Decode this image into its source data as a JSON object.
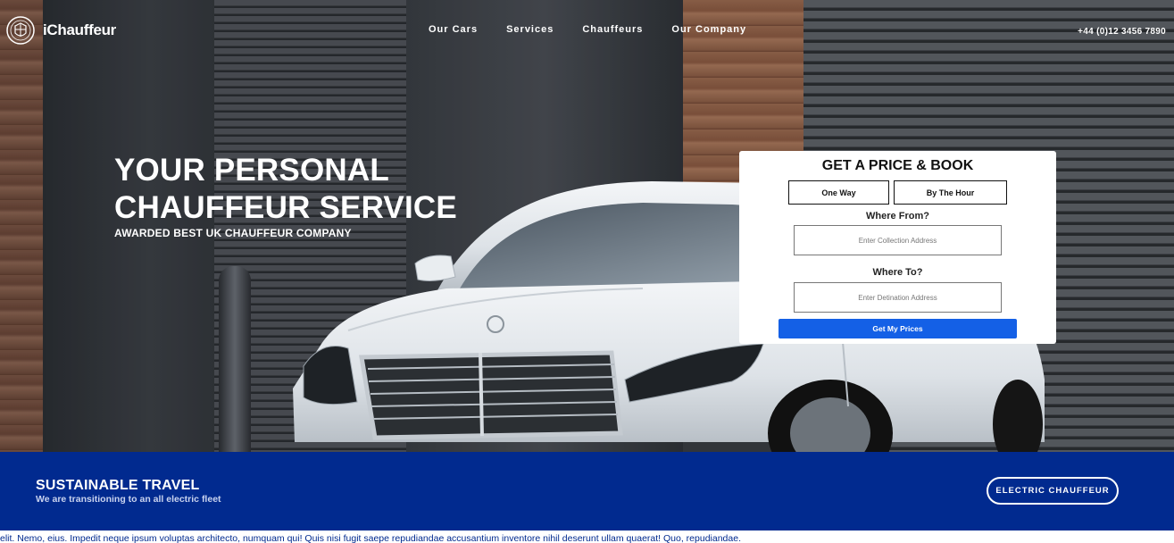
{
  "brand": {
    "name": "iChauffeur",
    "logo_icon": "crest-icon"
  },
  "nav": {
    "items": [
      "Our Cars",
      "Services",
      "Chauffeurs",
      "Our Company"
    ]
  },
  "phone": "+44 (0)12 3456 7890",
  "hero": {
    "title_line1": "YOUR PERSONAL",
    "title_line2": "CHAUFFEUR SERVICE",
    "subtitle": "AWARDED BEST UK CHAUFFEUR COMPANY"
  },
  "booking": {
    "title": "GET A PRICE & BOOK",
    "tab_one_way": "One Way",
    "tab_by_hour": "By The Hour",
    "from_label": "Where From?",
    "from_placeholder": "Enter Collection Address",
    "to_label": "Where To?",
    "to_placeholder": "Enter Detination Address",
    "cta": "Get My Prices",
    "cta_color": "#1460e6"
  },
  "sustainable": {
    "title": "SUSTAINABLE TRAVEL",
    "subtitle": "We are transitioning to an all electric fleet",
    "button": "ELECTRIC CHAUFFEUR",
    "background": "#012a8f"
  },
  "marquee": {
    "text": "elit. Nemo, eius. Impedit neque ipsum voluptas architecto, numquam qui! Quis nisi fugit saepe repudiandae accusantium inventore nihil deserunt ullam quaerat! Quo, repudiandae."
  }
}
